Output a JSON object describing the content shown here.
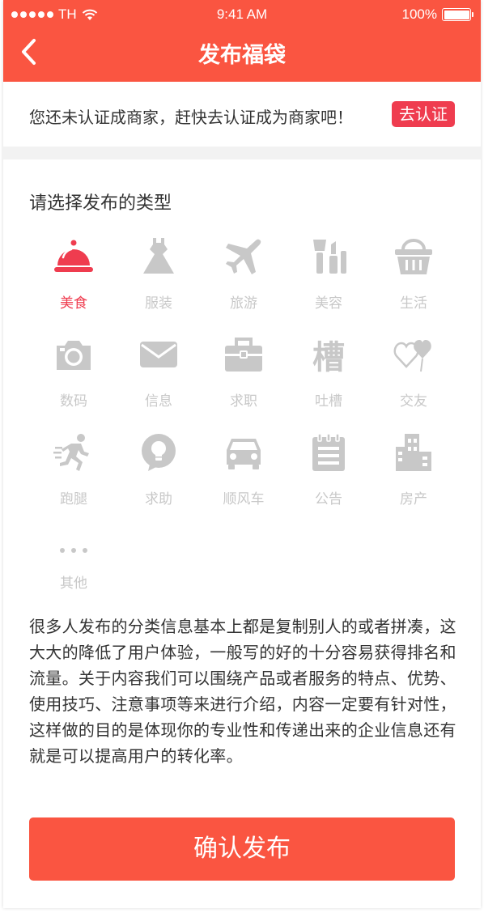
{
  "status_bar": {
    "carrier": "TH",
    "time": "9:41 AM",
    "battery": "100%"
  },
  "nav": {
    "title": "发布福袋",
    "back_icon": "chevron-left-icon"
  },
  "certification": {
    "message": "您还未认证成商家，赶快去认证成为商家吧！",
    "button": "去认证"
  },
  "section": {
    "title": "请选择发布的类型"
  },
  "categories": [
    {
      "label": "美食",
      "icon": "food-cloche-icon",
      "selected": true
    },
    {
      "label": "服装",
      "icon": "dress-icon",
      "selected": false
    },
    {
      "label": "旅游",
      "icon": "airplane-icon",
      "selected": false
    },
    {
      "label": "美容",
      "icon": "cosmetics-icon",
      "selected": false
    },
    {
      "label": "生活",
      "icon": "basket-icon",
      "selected": false
    },
    {
      "label": "数码",
      "icon": "camera-icon",
      "selected": false
    },
    {
      "label": "信息",
      "icon": "envelope-icon",
      "selected": false
    },
    {
      "label": "求职",
      "icon": "briefcase-icon",
      "selected": false
    },
    {
      "label": "吐槽",
      "icon": "rant-character-icon",
      "selected": false
    },
    {
      "label": "交友",
      "icon": "hearts-icon",
      "selected": false
    },
    {
      "label": "跑腿",
      "icon": "running-person-icon",
      "selected": false
    },
    {
      "label": "求助",
      "icon": "lightbulb-icon",
      "selected": false
    },
    {
      "label": "顺风车",
      "icon": "car-icon",
      "selected": false
    },
    {
      "label": "公告",
      "icon": "notepad-icon",
      "selected": false
    },
    {
      "label": "房产",
      "icon": "building-icon",
      "selected": false
    },
    {
      "label": "其他",
      "icon": "more-dots-icon",
      "selected": false
    }
  ],
  "description": "很多人发布的分类信息基本上都是复制别人的或者拼凑，这大大的降低了用户体验，一般写的好的十分容易获得排名和流量。关于内容我们可以围绕产品或者服务的特点、优势、使用技巧、注意事项等来进行介绍，内容一定要有针对性，这样做的目的是体现你的专业性和传递出来的企业信息还有就是可以提高用户的转化率。",
  "confirm_button": "确认发布",
  "colors": {
    "primary": "#fa5541",
    "accent_red": "#ef3c4f",
    "icon_inactive": "#c8c8c8"
  }
}
